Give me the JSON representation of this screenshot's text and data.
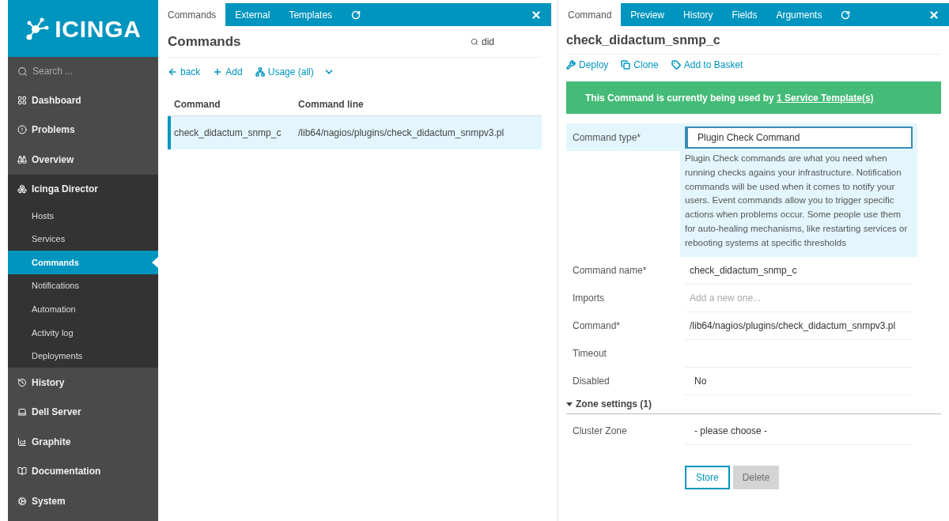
{
  "logo": {
    "text": "ICINGA"
  },
  "sidebar": {
    "search_placeholder": "Search ...",
    "items": [
      {
        "label": "Dashboard",
        "selected": false
      },
      {
        "label": "Problems",
        "selected": false
      },
      {
        "label": "Overview",
        "selected": false
      },
      {
        "label": "Icinga Director",
        "selected": false,
        "expanded": true,
        "children": [
          {
            "label": "Hosts",
            "selected": false
          },
          {
            "label": "Services",
            "selected": false
          },
          {
            "label": "Commands",
            "selected": true
          },
          {
            "label": "Notifications",
            "selected": false
          },
          {
            "label": "Automation",
            "selected": false
          },
          {
            "label": "Activity log",
            "selected": false
          },
          {
            "label": "Deployments",
            "selected": false
          }
        ]
      },
      {
        "label": "History",
        "selected": false
      },
      {
        "label": "Dell Server",
        "selected": false
      },
      {
        "label": "Graphite",
        "selected": false
      },
      {
        "label": "Documentation",
        "selected": false
      },
      {
        "label": "System",
        "selected": false
      }
    ]
  },
  "list_pane": {
    "tabs": [
      {
        "label": "Commands",
        "selected": true
      },
      {
        "label": "External",
        "selected": false
      },
      {
        "label": "Templates",
        "selected": false
      }
    ],
    "title": "Commands",
    "search": {
      "value": "did"
    },
    "actions": [
      {
        "label": "back"
      },
      {
        "label": "Add"
      },
      {
        "label": "Usage (all)"
      }
    ],
    "table": {
      "columns": [
        "Command",
        "Command line"
      ],
      "rows": [
        {
          "cells": [
            "check_didactum_snmp_c",
            "/lib64/nagios/plugins/check_didactum_snmpv3.pl"
          ],
          "selected": true
        }
      ]
    }
  },
  "detail_pane": {
    "tabs": [
      {
        "label": "Command",
        "selected": true
      },
      {
        "label": "Preview",
        "selected": false
      },
      {
        "label": "History",
        "selected": false
      },
      {
        "label": "Fields",
        "selected": false
      },
      {
        "label": "Arguments",
        "selected": false
      }
    ],
    "title": "check_didactum_snmp_c",
    "actions": [
      {
        "label": "Deploy"
      },
      {
        "label": "Clone"
      },
      {
        "label": "Add to Basket"
      }
    ],
    "alert": {
      "text": "This Command is currently being used by ",
      "link": "1 Service Template(s)"
    },
    "fields": [
      {
        "kind": "select",
        "label": "Command type*",
        "value": "Plugin Check Command",
        "focused": true,
        "description": "Plugin Check commands are what you need when running checks agains your infrastructure. Notification commands will be used when it comes to notify your users. Event commands allow you to trigger specific actions when problems occur. Some people use them for auto-healing mechanisms, like restarting services or rebooting systems at specific thresholds"
      },
      {
        "kind": "text",
        "label": "Command name*",
        "value": "check_didactum_snmp_c",
        "focused": false
      },
      {
        "kind": "text",
        "label": "Imports",
        "placeholder": "Add a new one...",
        "focused": false
      },
      {
        "kind": "text",
        "label": "Command*",
        "value": "/lib64/nagios/plugins/check_didactum_snmpv3.pl",
        "focused": false
      },
      {
        "kind": "text",
        "label": "Timeout",
        "focused": false
      },
      {
        "kind": "select",
        "label": "Disabled",
        "value": "No",
        "focused": false
      }
    ],
    "section": {
      "label": "Zone settings (1)",
      "expanded": true,
      "fields": [
        {
          "kind": "select",
          "label": "Cluster Zone",
          "value": "- please choose -",
          "focused": false
        }
      ]
    },
    "buttons": [
      {
        "label": "Store",
        "disabled": false
      },
      {
        "label": "Delete",
        "disabled": true
      }
    ]
  }
}
